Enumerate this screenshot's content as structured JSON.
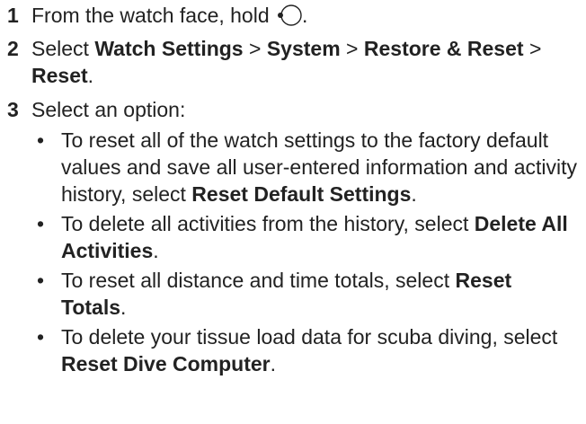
{
  "steps": [
    {
      "number": "1",
      "text_before": "From the watch face, hold ",
      "icon": "watch-button-icon",
      "text_after": "."
    },
    {
      "number": "2",
      "parts": [
        "Select ",
        "Watch Settings",
        " > ",
        "System",
        " > ",
        "Restore & Reset",
        " > ",
        "Reset",
        "."
      ]
    },
    {
      "number": "3",
      "text": "Select an option:",
      "bullet_char": "•",
      "options": [
        {
          "text": "To reset all of the watch settings to the factory default values and save all user-entered information and activity history, select ",
          "bold": "Reset Default Settings",
          "end": "."
        },
        {
          "text": "To delete all activities from the history, select ",
          "bold": "Delete All Activities",
          "end": "."
        },
        {
          "text": "To reset all distance and time totals, select ",
          "bold": "Reset Totals",
          "end": "."
        },
        {
          "text": "To delete your tissue load data for scuba diving, select ",
          "bold": "Reset Dive Computer",
          "end": "."
        }
      ]
    }
  ]
}
